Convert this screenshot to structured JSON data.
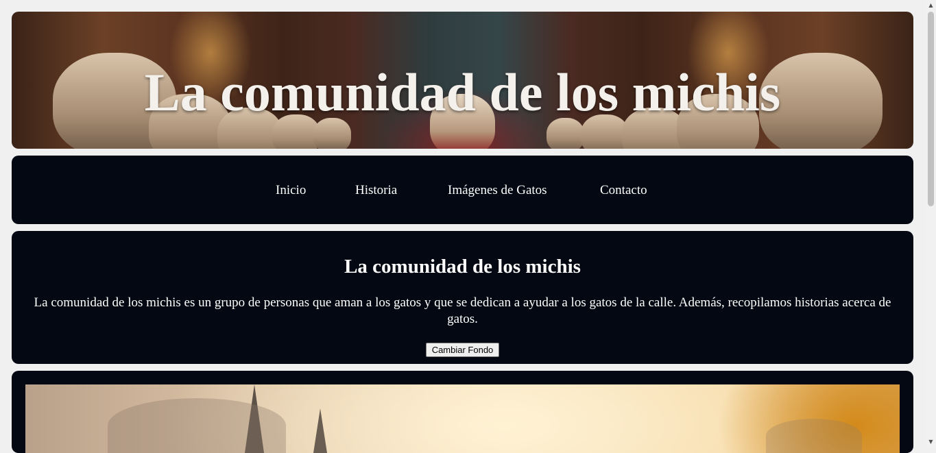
{
  "banner": {
    "title": "La comunidad de los michis"
  },
  "nav": {
    "items": [
      {
        "label": "Inicio"
      },
      {
        "label": "Historia"
      },
      {
        "label": "Imágenes de Gatos"
      },
      {
        "label": "Contacto"
      }
    ]
  },
  "intro": {
    "heading": "La comunidad de los michis",
    "text": "La comunidad de los michis es un grupo de personas que aman a los gatos y que se dedican a ayudar a los gatos de la calle. Además, recopilamos historias acerca de gatos.",
    "button_label": "Cambiar Fondo"
  },
  "scrollbar": {
    "up_icon": "▲",
    "down_icon": "▼"
  }
}
